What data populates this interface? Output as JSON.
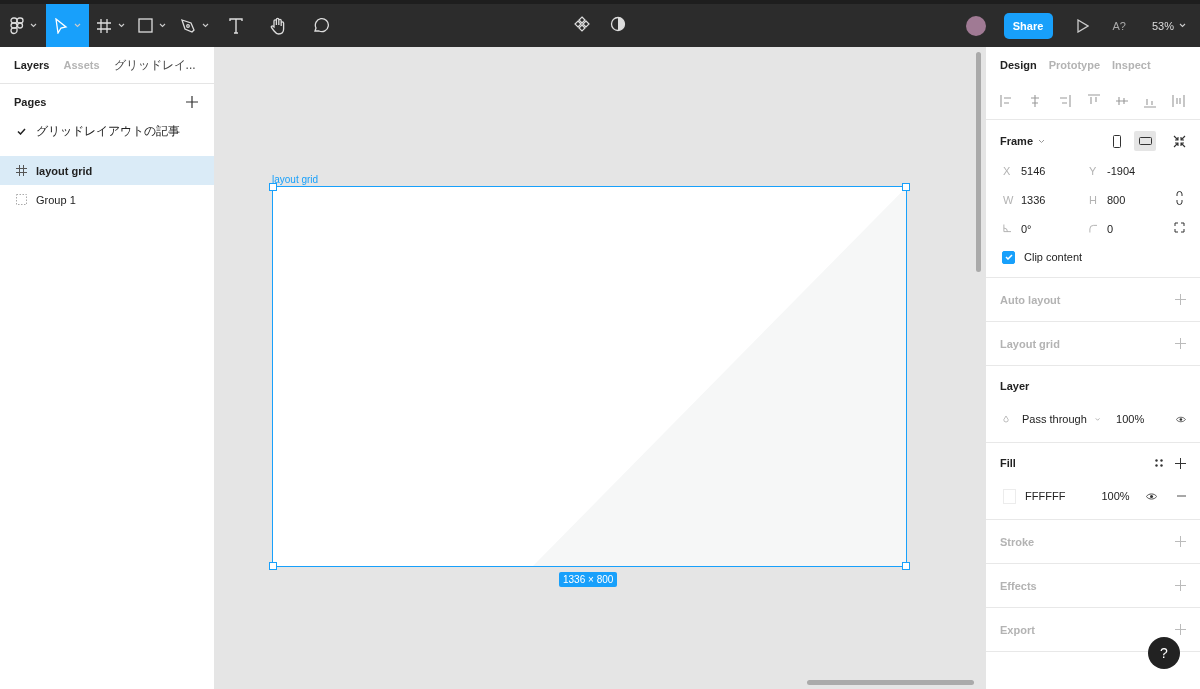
{
  "toolbar": {
    "tools": [
      {
        "kind": "menu",
        "selected": false,
        "caret": true
      },
      {
        "kind": "move",
        "selected": true,
        "caret": true
      },
      {
        "kind": "frame",
        "selected": false,
        "caret": true
      },
      {
        "kind": "shape",
        "selected": false,
        "caret": true
      },
      {
        "kind": "pen",
        "selected": false,
        "caret": true
      },
      {
        "kind": "text",
        "selected": false,
        "caret": false
      },
      {
        "kind": "hand",
        "selected": false,
        "caret": false
      },
      {
        "kind": "comment",
        "selected": false,
        "caret": false
      }
    ],
    "share": "Share",
    "font_check": "A?",
    "zoom": "53%"
  },
  "left_panel": {
    "tabs": [
      {
        "label": "Layers",
        "selected": true
      },
      {
        "label": "Assets",
        "selected": false
      }
    ],
    "page_dropdown": "グリッドレイ...",
    "pages_heading": "Pages",
    "pages": [
      {
        "name": "グリッドレイアウトの記事",
        "selected": true
      }
    ],
    "layers": [
      {
        "name": "layout grid",
        "kind": "frame",
        "selected": true
      },
      {
        "name": "Group 1",
        "kind": "group",
        "selected": false
      }
    ]
  },
  "canvas": {
    "frame_label": "layout grid",
    "size_badge": "1336 × 800"
  },
  "right_panel": {
    "tabs": [
      {
        "label": "Design",
        "selected": true
      },
      {
        "label": "Prototype",
        "selected": false
      },
      {
        "label": "Inspect",
        "selected": false
      }
    ],
    "frame": {
      "title": "Frame",
      "fields": [
        {
          "label": "X",
          "value": "5146"
        },
        {
          "label": "Y",
          "value": "-1904"
        },
        {
          "label": "W",
          "value": "1336"
        },
        {
          "label": "H",
          "value": "800"
        },
        {
          "kind": "angle",
          "value": "0°"
        },
        {
          "kind": "radius",
          "value": "0"
        }
      ],
      "clip_content": {
        "label": "Clip content",
        "checked": true
      }
    },
    "auto_layout": "Auto layout",
    "layout_grid": "Layout grid",
    "layer": {
      "title": "Layer",
      "blend": "Pass through",
      "opacity": "100%"
    },
    "fill": {
      "title": "Fill",
      "hex": "FFFFFF",
      "opacity": "100%"
    },
    "stroke": "Stroke",
    "effects": "Effects",
    "export": "Export",
    "help": "?"
  }
}
